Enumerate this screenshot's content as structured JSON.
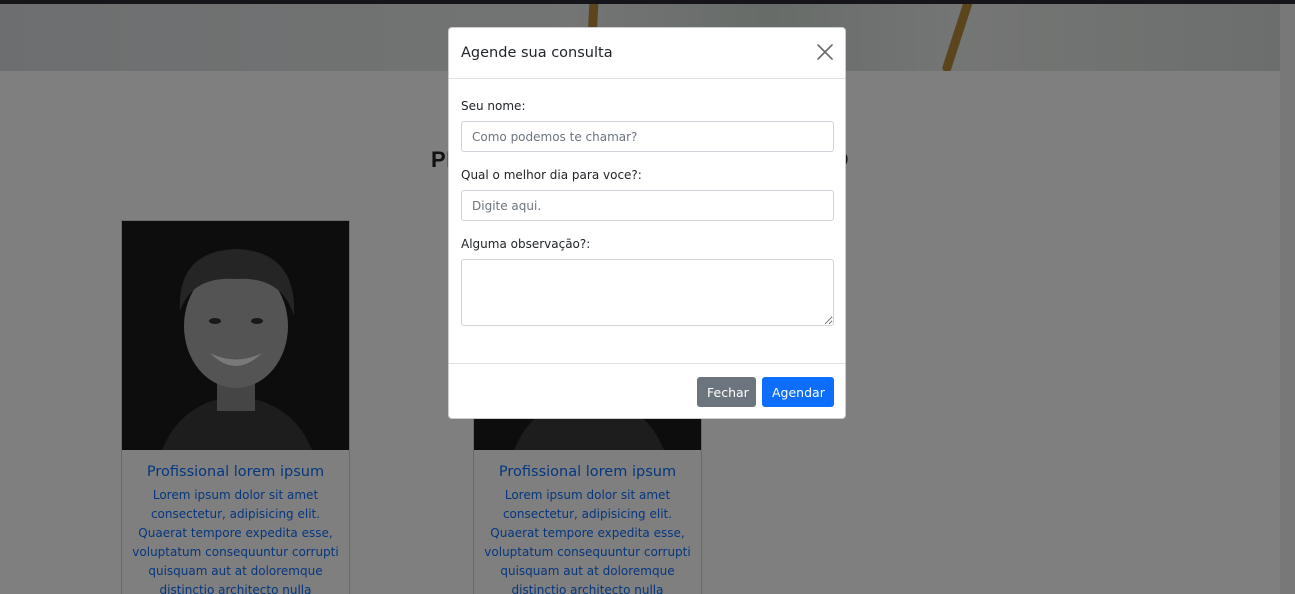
{
  "page": {
    "section_title": "PROFISSIONAIS PARA ATENDIMENTO",
    "cards": [
      {
        "title": "Profissional lorem ipsum",
        "text": "Lorem ipsum dolor sit amet consectetur, adipisicing elit. Quaerat tempore expedita esse, voluptatum consequuntur corrupti quisquam aut at doloremque distinctio architecto nulla"
      },
      {
        "title": "Profissional lorem ipsum",
        "text": "Lorem ipsum dolor sit amet consectetur, adipisicing elit. Quaerat tempore expedita esse, voluptatum consequuntur corrupti quisquam aut at doloremque distinctio architecto nulla"
      }
    ]
  },
  "modal": {
    "title": "Agende sua consulta",
    "close_icon": "close-icon",
    "fields": {
      "name_label": "Seu nome:",
      "name_placeholder": "Como podemos te chamar?",
      "name_value": "",
      "day_label": "Qual o melhor dia para voce?:",
      "day_placeholder": "Digite aqui.",
      "day_value": "",
      "notes_label": "Alguma observação?:",
      "notes_value": ""
    },
    "buttons": {
      "close_label": "Fechar",
      "submit_label": "Agendar"
    }
  },
  "colors": {
    "primary": "#0d6efd",
    "secondary": "#6c757d",
    "backdrop": "rgba(0,0,0,0.5)"
  }
}
